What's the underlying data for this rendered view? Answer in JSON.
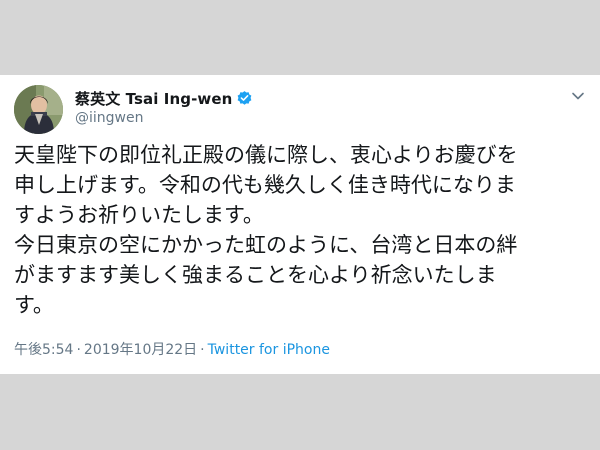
{
  "tweet": {
    "display_name": "蔡英文 Tsai Ing-wen",
    "handle": "@iingwen",
    "text_lines": [
      "天皇陛下の即位礼正殿の儀に際し、衷心よりお慶びを",
      "申し上げます。令和の代も幾久しく佳き時代になりま",
      "すようお祈りいたします。",
      "今日東京の空にかかった虹のように、台湾と日本の絆",
      "がますます美しく強まることを心より祈念いたしま",
      "す。"
    ],
    "time": "午後5:54",
    "separator": "·",
    "date": "2019年10月22日",
    "source": "Twitter for iPhone"
  },
  "colors": {
    "background": "#d6d6d6",
    "card": "#ffffff",
    "text": "#14171a",
    "secondary": "#657786",
    "link": "#1b95e0",
    "verified": "#1da1f2"
  },
  "icons": {
    "verified": "verified-badge-icon",
    "chevron": "chevron-down-icon",
    "avatar": "profile-photo"
  }
}
